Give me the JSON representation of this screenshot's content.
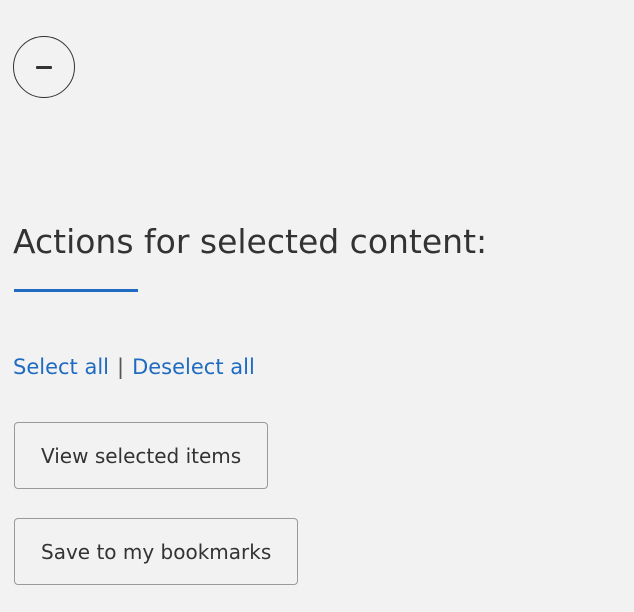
{
  "panel": {
    "collapse_button_label": "−",
    "section_title": "Actions for selected content:",
    "select_all_label": "Select all",
    "separator": "|",
    "deselect_all_label": "Deselect all"
  },
  "actions": {
    "view_selected_label": "View selected items",
    "save_bookmarks_label": "Save to my bookmarks"
  },
  "colors": {
    "accent": "#1f6bc1",
    "background": "#f2f2f2",
    "text": "#333333"
  },
  "icons": {
    "collapse": "minus-circle-icon"
  }
}
